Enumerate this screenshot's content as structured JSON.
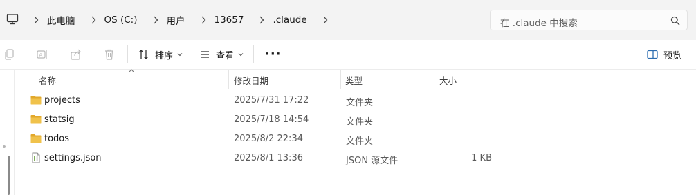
{
  "address_bar": {
    "crumbs": [
      "此电脑",
      "OS (C:)",
      "用户",
      "13657",
      ".claude"
    ]
  },
  "search": {
    "placeholder": "在 .claude 中搜索"
  },
  "command_bar": {
    "sort_label": "排序",
    "view_label": "查看",
    "more_label": "···",
    "preview_label": "预览"
  },
  "columns": {
    "name": "名称",
    "date": "修改日期",
    "type": "类型",
    "size": "大小"
  },
  "files": [
    {
      "name": "projects",
      "date": "2025/7/31 17:22",
      "type": "文件夹",
      "size": "",
      "kind": "folder-icon"
    },
    {
      "name": "statsig",
      "date": "2025/7/18 14:54",
      "type": "文件夹",
      "size": "",
      "kind": "folder-icon"
    },
    {
      "name": "todos",
      "date": "2025/8/2 22:34",
      "type": "文件夹",
      "size": "",
      "kind": "folder-icon"
    },
    {
      "name": "settings.json",
      "date": "2025/8/1 13:36",
      "type": "JSON 源文件",
      "size": "1 KB",
      "kind": "json-file-icon"
    }
  ],
  "colors": {
    "folder": "#f0c24b",
    "folder_dark": "#e2a82b",
    "preview_accent": "#2b6cb0"
  }
}
